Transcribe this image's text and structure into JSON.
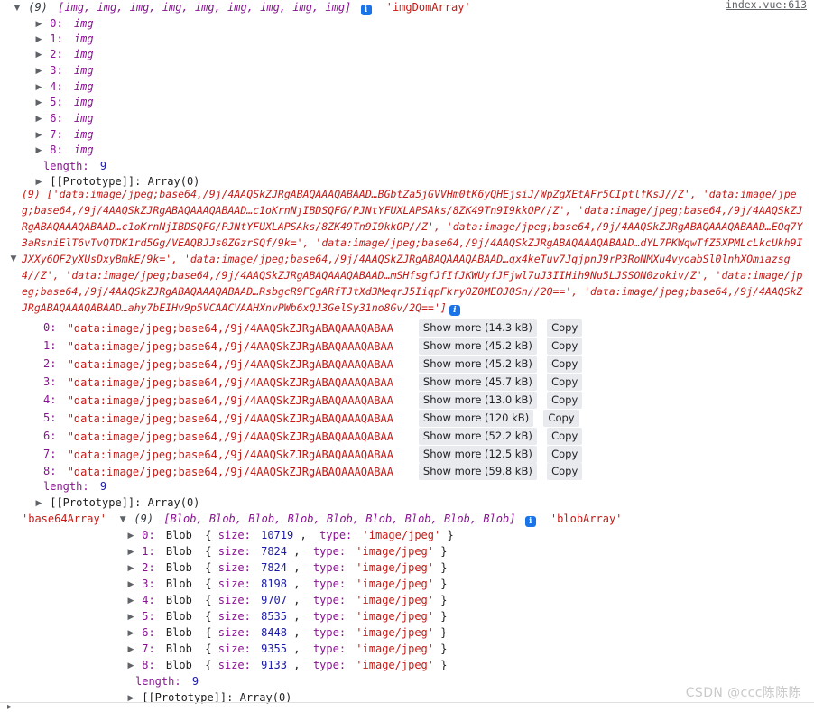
{
  "meta": {
    "app": "Chrome DevTools Console",
    "watermark": "CSDN @ccc陈陈陈",
    "colors": {
      "string": "#c41a16",
      "number": "#1a1aa6",
      "key": "#881391",
      "info_badge": "#1a73e8",
      "button_bg": "#e8eaed",
      "background": "#ffffff"
    }
  },
  "log_groups": [
    {
      "id": "imgDomArray",
      "header": {
        "triangle": "open",
        "count": "(9)",
        "preview": "[img, img, img, img, img, img, img, img, img]",
        "info_icon": "info-icon",
        "label": "'imgDomArray'",
        "source": "index.vue:613"
      },
      "items": [
        {
          "index": "0:",
          "value": "img"
        },
        {
          "index": "1:",
          "value": "img"
        },
        {
          "index": "2:",
          "value": "img"
        },
        {
          "index": "3:",
          "value": "img"
        },
        {
          "index": "4:",
          "value": "img"
        },
        {
          "index": "5:",
          "value": "img"
        },
        {
          "index": "6:",
          "value": "img"
        },
        {
          "index": "7:",
          "value": "img"
        },
        {
          "index": "8:",
          "value": "img"
        }
      ],
      "length_key": "length:",
      "length_value": "9",
      "prototype": "[[Prototype]]: Array(0)"
    }
  ],
  "base64_group": {
    "header": {
      "count": "(9)",
      "text": "['data:image/jpeg;base64,/9j/4AAQSkZJRgABAQAAAQABAAD…BGbtZa5jGVVHm0tK6yQHEjsiJ/WpZgXEtAFr5CIptlfKsJ//Z', 'data:image/jpeg;base64,/9j/4AAQSkZJRgABAQAAAQABAAD…c1oKrnNjIBDSQFG/PJNtYFUXLAPSAks/8ZK49Tn9I9kkOP//Z', 'data:image/jpeg;base64,/9j/4AAQSkZJRgABAQAAAQABAAD…c1oKrnNjIBDSQFG/PJNtYFUXLAPSAks/8ZK49Tn9I9kkOP//Z', 'data:image/jpeg;base64,/9j/4AAQSkZJRgABAQAAAQABAAD…EOq7Y3aRsniElT6vTvQTDK1rd5Gg/VEAQBJJs0ZGzrSQf/9k=', 'data:image/jpeg;base64,/9j/4AAQSkZJRgABAQAAAQABAAD…dYL7PKWqwTfZ5XPMLcLkcUkh9IJXXy6OF2yXUsDxyBmkE/9k=', 'data:image/jpeg;base64,/9j/4AAQSkZJRgABAQAAAQABAAD…qx4keTuv7JqjpnJ9rP3RoNMXu4vyoabSl0lnhXOmiazsg4//Z', 'data:image/jpeg;base64,/9j/4AAQSkZJRgABAQAAAQABAAD…mSHfsgfJfIfJKWUyfJFjwl7uJ3IIHih9Nu5LJSSON0zokiv/Z', 'data:image/jpeg;base64,/9j/4AAQSkZJRgABAQAAAQABAAD…RsbgcR9FCgARfTJtXd3MeqrJ5IiqpFkryOZ0MEOJ0Sn//2Q==', 'data:image/jpeg;base64,/9j/4AAQSkZJRgABAQAAAQABAAD…ahy7bEIHv9p5VCAACVAAHXnvPWb6xQJ3GelSy31no8Gv/2Q==']",
      "info_icon": "info-icon"
    },
    "rows": [
      {
        "index": "0:",
        "value": "\"data:image/jpeg;base64,/9j/4AAQSkZJRgABAQAAAQABAA",
        "show_more": "Show more (14.3 kB)",
        "copy": "Copy"
      },
      {
        "index": "1:",
        "value": "\"data:image/jpeg;base64,/9j/4AAQSkZJRgABAQAAAQABAA",
        "show_more": "Show more (45.2 kB)",
        "copy": "Copy"
      },
      {
        "index": "2:",
        "value": "\"data:image/jpeg;base64,/9j/4AAQSkZJRgABAQAAAQABAA",
        "show_more": "Show more (45.2 kB)",
        "copy": "Copy"
      },
      {
        "index": "3:",
        "value": "\"data:image/jpeg;base64,/9j/4AAQSkZJRgABAQAAAQABAA",
        "show_more": "Show more (45.7 kB)",
        "copy": "Copy"
      },
      {
        "index": "4:",
        "value": "\"data:image/jpeg;base64,/9j/4AAQSkZJRgABAQAAAQABAA",
        "show_more": "Show more (13.0 kB)",
        "copy": "Copy"
      },
      {
        "index": "5:",
        "value": "\"data:image/jpeg;base64,/9j/4AAQSkZJRgABAQAAAQABAA",
        "show_more": "Show more (120 kB)",
        "copy": "Copy"
      },
      {
        "index": "6:",
        "value": "\"data:image/jpeg;base64,/9j/4AAQSkZJRgABAQAAAQABAA",
        "show_more": "Show more (52.2 kB)",
        "copy": "Copy"
      },
      {
        "index": "7:",
        "value": "\"data:image/jpeg;base64,/9j/4AAQSkZJRgABAQAAAQABAA",
        "show_more": "Show more (12.5 kB)",
        "copy": "Copy"
      },
      {
        "index": "8:",
        "value": "\"data:image/jpeg;base64,/9j/4AAQSkZJRgABAQAAAQABAA",
        "show_more": "Show more (59.8 kB)",
        "copy": "Copy"
      }
    ],
    "length_key": "length:",
    "length_value": "9",
    "prototype": "[[Prototype]]: Array(0)"
  },
  "blob_group": {
    "label": "'base64Array'",
    "header": {
      "count": "(9)",
      "preview": "[Blob, Blob, Blob, Blob, Blob, Blob, Blob, Blob, Blob]",
      "info_icon": "info-icon",
      "trailing_label": "'blobArray'"
    },
    "items": [
      {
        "index": "0:",
        "ctor": "Blob",
        "size_key": "size:",
        "size": "10719",
        "type_key": "type:",
        "type": "'image/jpeg'"
      },
      {
        "index": "1:",
        "ctor": "Blob",
        "size_key": "size:",
        "size": "7824",
        "type_key": "type:",
        "type": "'image/jpeg'"
      },
      {
        "index": "2:",
        "ctor": "Blob",
        "size_key": "size:",
        "size": "7824",
        "type_key": "type:",
        "type": "'image/jpeg'"
      },
      {
        "index": "3:",
        "ctor": "Blob",
        "size_key": "size:",
        "size": "8198",
        "type_key": "type:",
        "type": "'image/jpeg'"
      },
      {
        "index": "4:",
        "ctor": "Blob",
        "size_key": "size:",
        "size": "9707",
        "type_key": "type:",
        "type": "'image/jpeg'"
      },
      {
        "index": "5:",
        "ctor": "Blob",
        "size_key": "size:",
        "size": "8535",
        "type_key": "type:",
        "type": "'image/jpeg'"
      },
      {
        "index": "6:",
        "ctor": "Blob",
        "size_key": "size:",
        "size": "8448",
        "type_key": "type:",
        "type": "'image/jpeg'"
      },
      {
        "index": "7:",
        "ctor": "Blob",
        "size_key": "size:",
        "size": "9355",
        "type_key": "type:",
        "type": "'image/jpeg'"
      },
      {
        "index": "8:",
        "ctor": "Blob",
        "size_key": "size:",
        "size": "9133",
        "type_key": "type:",
        "type": "'image/jpeg'"
      }
    ],
    "length_key": "length:",
    "length_value": "9",
    "prototype": "[[Prototype]]: Array(0)"
  }
}
